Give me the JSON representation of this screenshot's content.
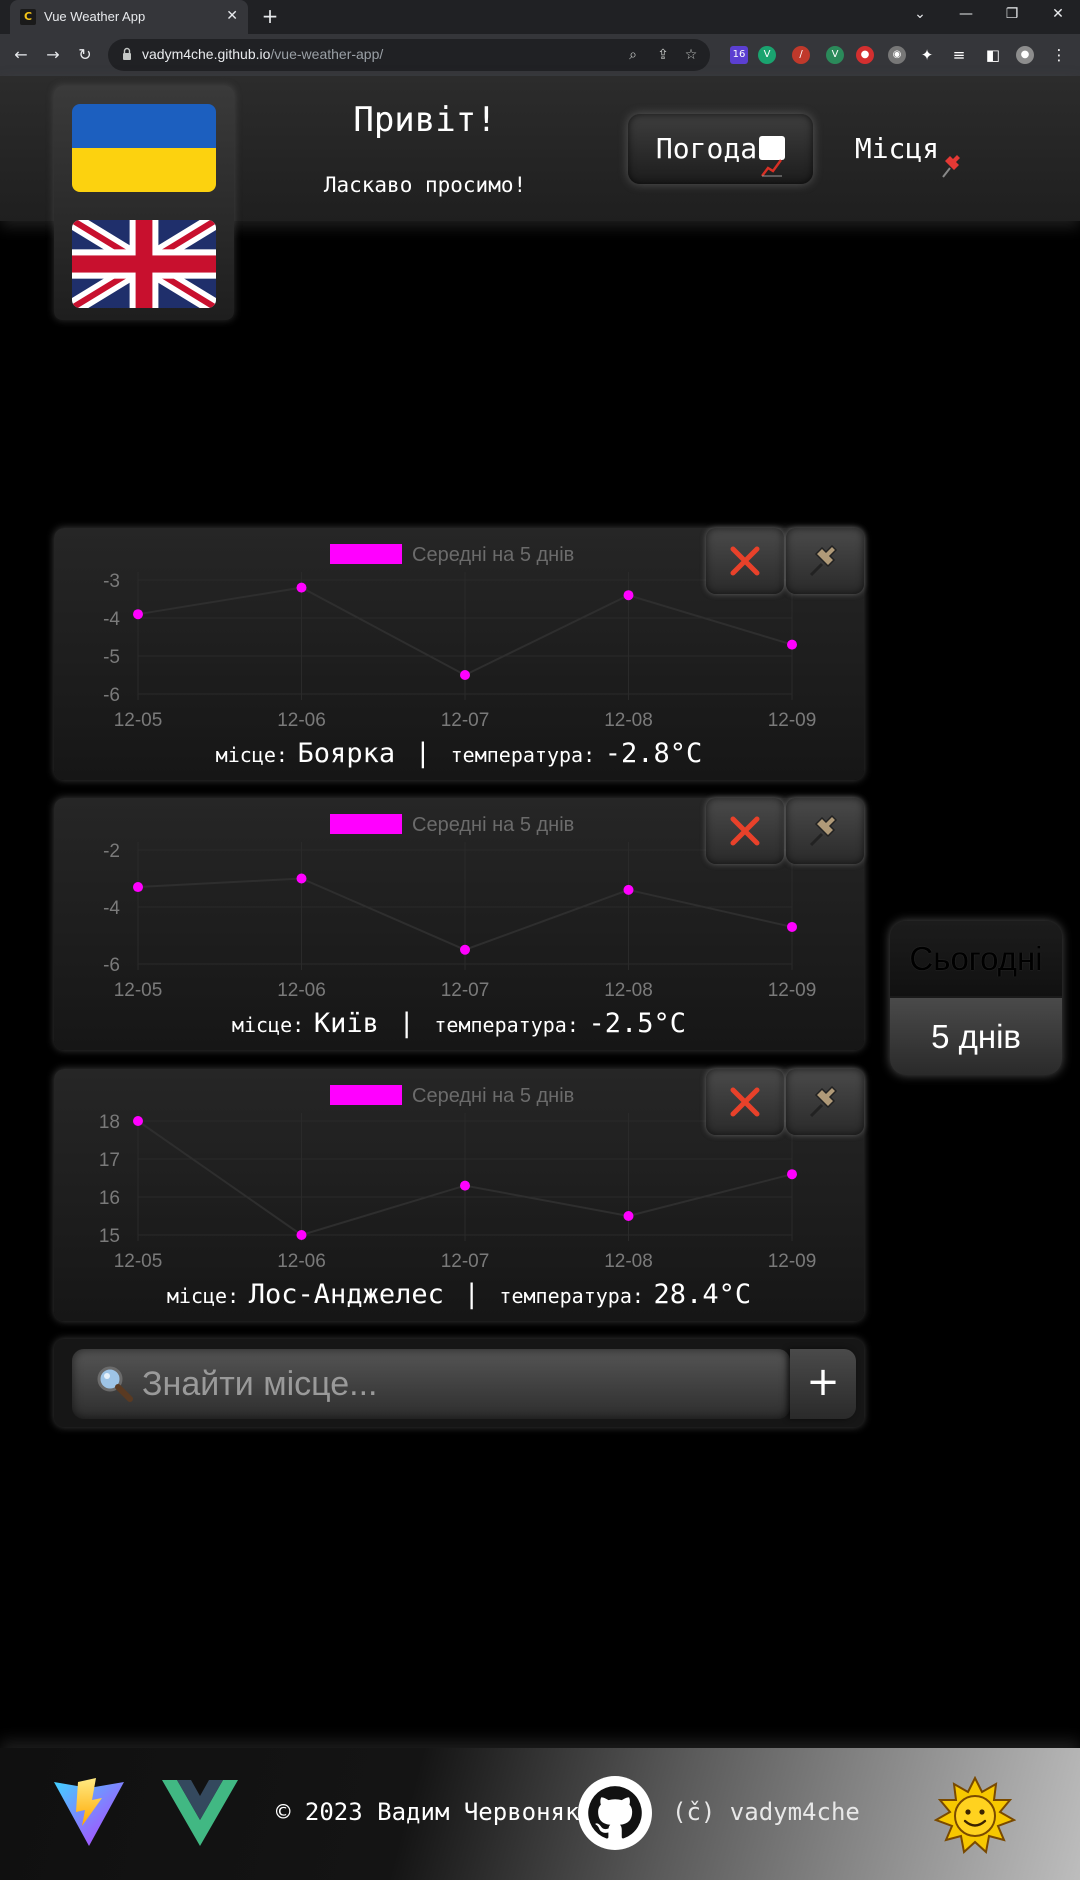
{
  "browser": {
    "tab_title": "Vue Weather App",
    "url_host": "vadym4che.github.io",
    "url_path": "/vue-weather-app/",
    "extension_badge": "16"
  },
  "header": {
    "greeting": "Привіт!",
    "welcome": "Ласкаво просимо!",
    "nav_weather": "Погода",
    "nav_places": "Місця"
  },
  "labels": {
    "place": "місце:",
    "temperature": "температура:",
    "separator": "|"
  },
  "cards": [
    {
      "place": "Боярка",
      "temperature": "-2.8°C"
    },
    {
      "place": "Київ",
      "temperature": "-2.5°C"
    },
    {
      "place": "Лос-Анджелес",
      "temperature": "28.4°C"
    }
  ],
  "chart_data": [
    {
      "type": "scatter",
      "legend": "Середні на 5 днів",
      "x": [
        "12-05",
        "12-06",
        "12-07",
        "12-08",
        "12-09"
      ],
      "series": [
        {
          "name": "Середні на 5 днів",
          "values": [
            -3.9,
            -3.2,
            -5.5,
            -3.4,
            -4.7
          ]
        }
      ],
      "ylim": [
        -6,
        -3
      ],
      "yticks": [
        -3,
        -4,
        -5,
        -6
      ],
      "color": "#ff00ff"
    },
    {
      "type": "scatter",
      "legend": "Середні на 5 днів",
      "x": [
        "12-05",
        "12-06",
        "12-07",
        "12-08",
        "12-09"
      ],
      "series": [
        {
          "name": "Середні на 5 днів",
          "values": [
            -3.3,
            -3.0,
            -5.5,
            -3.4,
            -4.7
          ]
        }
      ],
      "ylim": [
        -6,
        -2
      ],
      "yticks": [
        -2,
        -4,
        -6
      ],
      "color": "#ff00ff"
    },
    {
      "type": "scatter",
      "legend": "Середні на 5 днів",
      "x": [
        "12-05",
        "12-06",
        "12-07",
        "12-08",
        "12-09"
      ],
      "series": [
        {
          "name": "Середні на 5 днів",
          "values": [
            18.0,
            15.0,
            16.3,
            15.5,
            16.6
          ]
        }
      ],
      "ylim": [
        15,
        18
      ],
      "yticks": [
        18,
        17,
        16,
        15
      ],
      "color": "#ff00ff"
    }
  ],
  "side_toggle": {
    "today": "Сьогодні",
    "five_days": "5 днів"
  },
  "search": {
    "placeholder": "Знайти місце...",
    "add_label": "+"
  },
  "footer": {
    "copyright": "© 2023 Вадим Червоняк",
    "handle": "(č) vadym4che"
  },
  "colors": {
    "accent": "#ff00ff",
    "flag_ua_blue": "#1c5fbf",
    "flag_ua_yellow": "#fcd20f",
    "close_red": "#e8412a"
  },
  "icons": [
    "ua-flag-icon",
    "uk-flag-icon",
    "chart-emoji-icon",
    "pin-emoji-icon",
    "close-icon",
    "pushpin-icon",
    "magnifier-icon",
    "vite-logo-icon",
    "vue-logo-icon",
    "github-icon",
    "sun-emoji-icon"
  ]
}
